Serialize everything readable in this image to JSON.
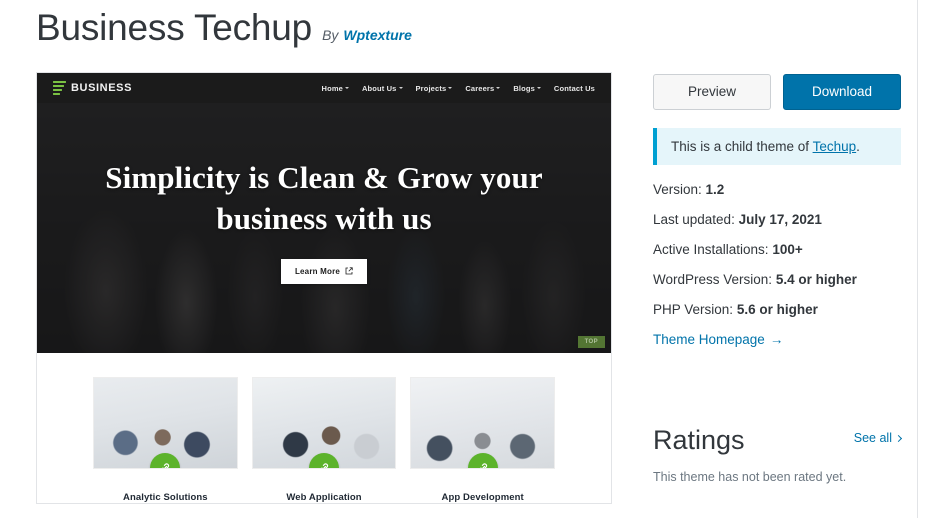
{
  "header": {
    "title": "Business Techup",
    "by_label": "By",
    "author": "Wptexture"
  },
  "actions": {
    "preview_label": "Preview",
    "download_label": "Download"
  },
  "notice": {
    "text_before": "This is a child theme of ",
    "link": "Techup",
    "text_after": "."
  },
  "meta": [
    {
      "label": "Version:",
      "value": "1.2"
    },
    {
      "label": "Last updated:",
      "value": "July 17, 2021"
    },
    {
      "label": "Active Installations:",
      "value": "100+"
    },
    {
      "label": "WordPress Version:",
      "value": "5.4 or higher"
    },
    {
      "label": "PHP Version:",
      "value": "5.6 or higher"
    }
  ],
  "homepage": {
    "label": "Theme Homepage",
    "arrow": "→"
  },
  "ratings": {
    "title": "Ratings",
    "see_all": "See all",
    "empty_text": "This theme has not been rated yet."
  },
  "preview": {
    "brand": "BUSINESS",
    "nav": [
      {
        "label": "Home",
        "has_dropdown": true
      },
      {
        "label": "About Us",
        "has_dropdown": true
      },
      {
        "label": "Projects",
        "has_dropdown": true
      },
      {
        "label": "Careers",
        "has_dropdown": true
      },
      {
        "label": "Blogs",
        "has_dropdown": true
      },
      {
        "label": "Contact Us",
        "has_dropdown": false
      }
    ],
    "hero_title": "Simplicity is Clean & Grow your business with us",
    "hero_button": "Learn More",
    "top_button": "TOP",
    "services": [
      {
        "title": "Analytic Solutions"
      },
      {
        "title": "Web Application"
      },
      {
        "title": "App Development"
      }
    ]
  },
  "colors": {
    "accent_blue": "#0073aa",
    "notice_border": "#00a0d2",
    "notice_bg": "#e5f5fa",
    "brand_green": "#7ac143",
    "badge_green": "#5cb32b",
    "text_dark": "#32373c"
  }
}
